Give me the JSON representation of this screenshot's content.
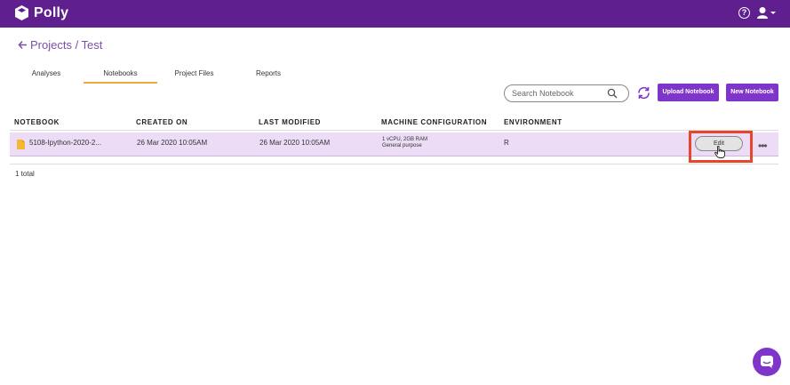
{
  "app": {
    "name": "Polly"
  },
  "breadcrumb": {
    "text": "Projects / Test"
  },
  "tabs": [
    {
      "label": "Analyses"
    },
    {
      "label": "Notebooks"
    },
    {
      "label": "Project Files"
    },
    {
      "label": "Reports"
    }
  ],
  "active_tab": "Notebooks",
  "search": {
    "placeholder": "Search Notebook",
    "value": ""
  },
  "actions": {
    "upload_label": "Upload Notebook",
    "new_label": "New Notebook"
  },
  "table": {
    "columns": [
      "NOTEBOOK",
      "CREATED ON",
      "LAST MODIFIED",
      "MACHINE CONFIGURATION",
      "ENVIRONMENT"
    ],
    "rows": [
      {
        "notebook": "5108-Ipython-2020-2...",
        "created_on": "26 Mar 2020 10:05AM",
        "last_modified": "26 Mar 2020 10:05AM",
        "machine_line1": "1 vCPU, 2GB RAM",
        "machine_line2": "General purpose",
        "environment": "R",
        "edit_label": "Edit",
        "more_label": "•••"
      }
    ],
    "total": "1 total"
  },
  "colors": {
    "topbar": "#5f1f8f",
    "accent": "#7f35c9",
    "breadcrumb": "#7b4fa8",
    "tab_underline": "#f0a93b",
    "row_highlight": "#ecdcf6",
    "focus_box": "#e8462b",
    "file_icon": "#f5b731"
  },
  "icons": [
    "polly-logo-icon",
    "help-icon",
    "user-icon",
    "arrow-left-icon",
    "search-icon",
    "refresh-icon",
    "file-icon",
    "more-icon",
    "hand-cursor-icon",
    "chat-icon"
  ]
}
